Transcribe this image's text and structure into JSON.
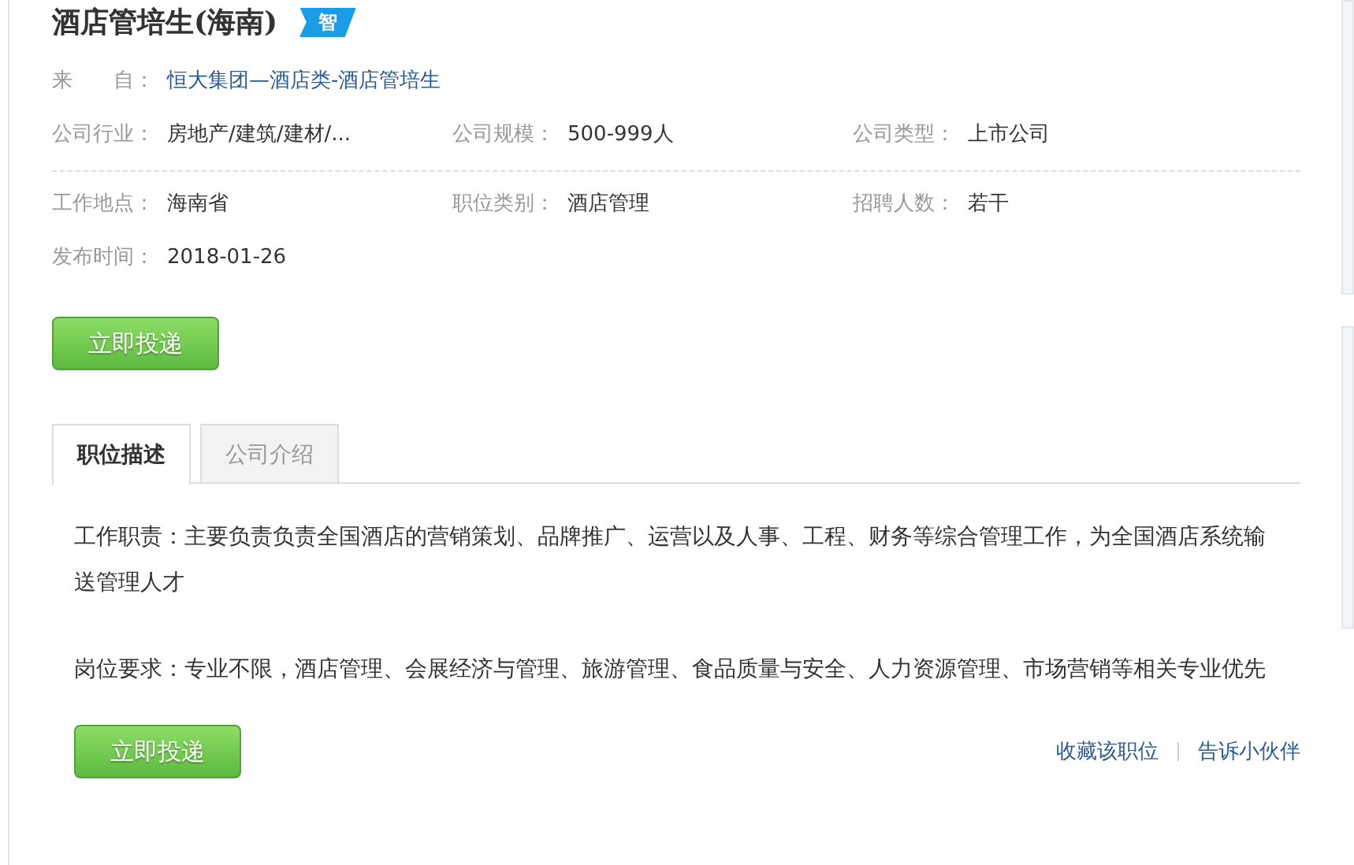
{
  "job": {
    "title": "酒店管培生(海南)",
    "badge": "智"
  },
  "source": {
    "label": "来　　自：",
    "value": "恒大集团—酒店类-酒店管培生"
  },
  "info_rows": [
    [
      {
        "label": "公司行业：",
        "value": "房地产/建筑/建材/..."
      },
      {
        "label": "公司规模：",
        "value": "500-999人"
      },
      {
        "label": "公司类型：",
        "value": "上市公司"
      }
    ],
    [
      {
        "label": "工作地点：",
        "value": "海南省"
      },
      {
        "label": "职位类别：",
        "value": "酒店管理"
      },
      {
        "label": "招聘人数：",
        "value": "若干"
      }
    ]
  ],
  "publish": {
    "label": "发布时间：",
    "value": "2018-01-26"
  },
  "apply_button": "立即投递",
  "tabs": [
    {
      "label": "职位描述",
      "selected": true
    },
    {
      "label": "公司介绍",
      "selected": false
    }
  ],
  "description": [
    "工作职责：主要负责负责全国酒店的营销策划、品牌推广、运营以及人事、工程、财务等综合管理工作，为全国酒店系统输送管理人才",
    "岗位要求：专业不限，酒店管理、会展经济与管理、旅游管理、食品质量与安全、人力资源管理、市场营销等相关专业优先"
  ],
  "bottom_button": "立即投递",
  "links": [
    "收藏该职位",
    "告诉小伙伴"
  ]
}
